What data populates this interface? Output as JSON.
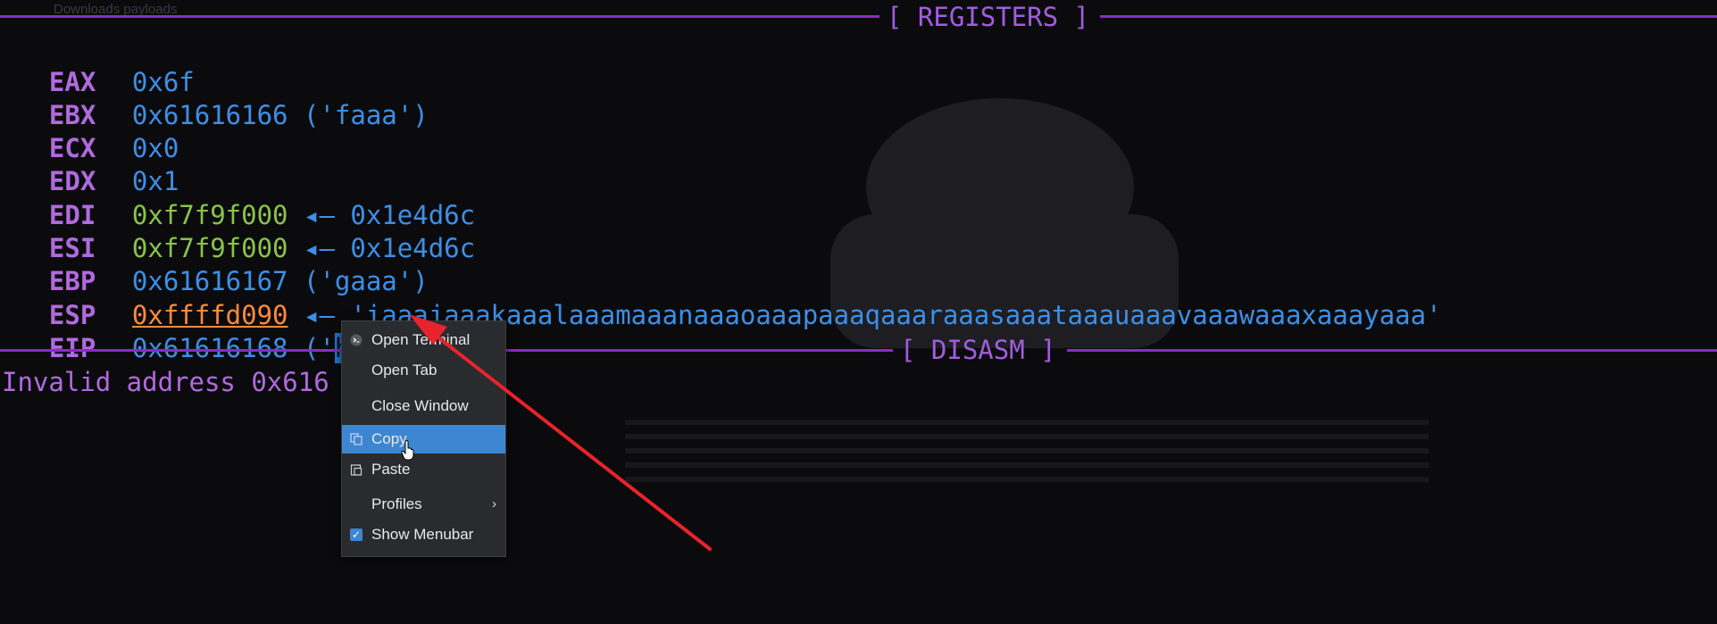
{
  "window": {
    "path_title": "Downloads   payloads"
  },
  "banners": {
    "registers": "[ REGISTERS ]",
    "disasm": "[ DISASM ]"
  },
  "registers": [
    {
      "name": "EAX",
      "value": "0x6f",
      "note": ""
    },
    {
      "name": "EBX",
      "value": "0x61616166",
      "note": "('faaa')"
    },
    {
      "name": "ECX",
      "value": "0x0",
      "note": ""
    },
    {
      "name": "EDX",
      "value": "0x1",
      "note": ""
    },
    {
      "name": "EDI",
      "value": "0xf7f9f000",
      "arrow": "◂—",
      "note": "0x1e4d6c"
    },
    {
      "name": "ESI",
      "value": "0xf7f9f000",
      "arrow": "◂—",
      "note": "0x1e4d6c"
    },
    {
      "name": "EBP",
      "value": "0x61616167",
      "note": "('gaaa')"
    },
    {
      "name": "ESP",
      "value": "0xffffd090",
      "arrow": "◂—",
      "note": "'iaaajaaakaaalaaamaaanaaaoaaapaaaqaaaraaasaaataaauaaavaaawaaaxaaayaaa'"
    },
    {
      "name": "EIP",
      "value": "0x61616168",
      "note_pre": "('",
      "note_sel": "haaa",
      "note_post": "')"
    }
  ],
  "disasm": {
    "message": "Invalid address 0x616"
  },
  "context_menu": {
    "items": [
      {
        "label": "Open Terminal",
        "icon": "terminal-icon"
      },
      {
        "label": "Open Tab",
        "icon": ""
      },
      {
        "label": "Close Window",
        "icon": ""
      },
      {
        "label": "Copy",
        "icon": "copy-icon",
        "highlighted": true
      },
      {
        "label": "Paste",
        "icon": "paste-icon"
      },
      {
        "label": "Profiles",
        "icon": "",
        "submenu": true
      },
      {
        "label": "Show Menubar",
        "icon": "checkbox-icon",
        "checked": true
      }
    ]
  },
  "colors": {
    "background": "#0b0b0d",
    "purple_rule": "#8a2bc9",
    "register_name": "#b06adf",
    "value_blue": "#3d8fe8",
    "value_green": "#8bc34a",
    "value_orange": "#ff8a3c",
    "menu_highlight": "#3d86d2",
    "annotation_arrow": "#e8232b"
  }
}
